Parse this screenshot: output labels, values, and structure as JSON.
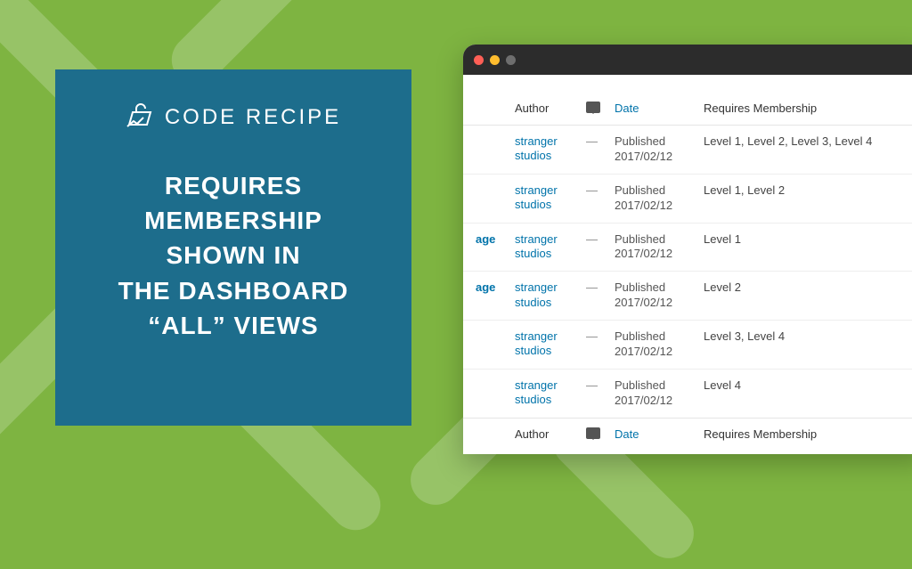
{
  "brand": {
    "label": "CODE RECIPE"
  },
  "headline": "REQUIRES\nMEMBERSHIP\nSHOWN IN\nTHE DASHBOARD\n“ALL” VIEWS",
  "table": {
    "headers": {
      "author": "Author",
      "date": "Date",
      "membership": "Requires Membership"
    },
    "rows": [
      {
        "title": "",
        "author": "stranger studios",
        "comments": "—",
        "date_status": "Published",
        "date": "2017/02/12",
        "membership": "Level 1, Level 2, Level 3, Level 4"
      },
      {
        "title": "",
        "author": "stranger studios",
        "comments": "—",
        "date_status": "Published",
        "date": "2017/02/12",
        "membership": "Level 1, Level 2"
      },
      {
        "title": "age",
        "author": "stranger studios",
        "comments": "—",
        "date_status": "Published",
        "date": "2017/02/12",
        "membership": "Level 1"
      },
      {
        "title": "age",
        "author": "stranger studios",
        "comments": "—",
        "date_status": "Published",
        "date": "2017/02/12",
        "membership": "Level 2"
      },
      {
        "title": "",
        "author": "stranger studios",
        "comments": "—",
        "date_status": "Published",
        "date": "2017/02/12",
        "membership": "Level 3, Level 4"
      },
      {
        "title": "",
        "author": "stranger studios",
        "comments": "—",
        "date_status": "Published",
        "date": "2017/02/12",
        "membership": "Level 4"
      }
    ]
  }
}
